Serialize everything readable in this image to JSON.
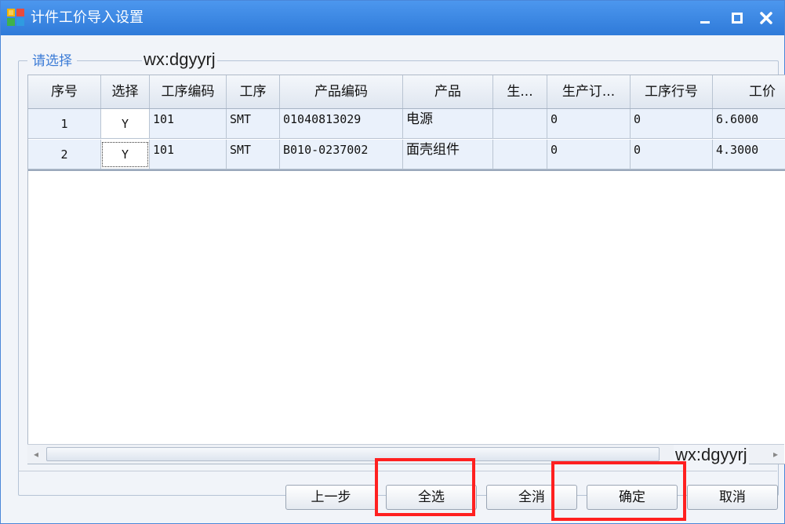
{
  "window": {
    "title": "计件工价导入设置",
    "accent_color": "#2f7ad9",
    "controls": [
      "minimize-icon",
      "maximize-icon",
      "close-icon"
    ]
  },
  "group": {
    "label": "请选择"
  },
  "watermarks": {
    "top": "wx:dgyyrj",
    "bottom": "wx:dgyyrj"
  },
  "table": {
    "columns": [
      "序号",
      "选择",
      "工序编码",
      "工序",
      "产品编码",
      "产品",
      "生...",
      "生产订...",
      "工序行号",
      "工价"
    ],
    "rows": [
      [
        "1",
        "Y",
        "101",
        "SMT",
        "01040813029",
        "电源",
        "",
        "0",
        "0",
        "6.6000"
      ],
      [
        "2",
        "Y",
        "101",
        "SMT",
        "B010-0237002",
        "面壳组件",
        "",
        "0",
        "0",
        "4.3000"
      ]
    ]
  },
  "buttons": {
    "prev": "上一步",
    "select_all": "全选",
    "clear_all": "全消",
    "confirm": "确定",
    "cancel": "取消"
  },
  "highlight_color": "#ff2020"
}
